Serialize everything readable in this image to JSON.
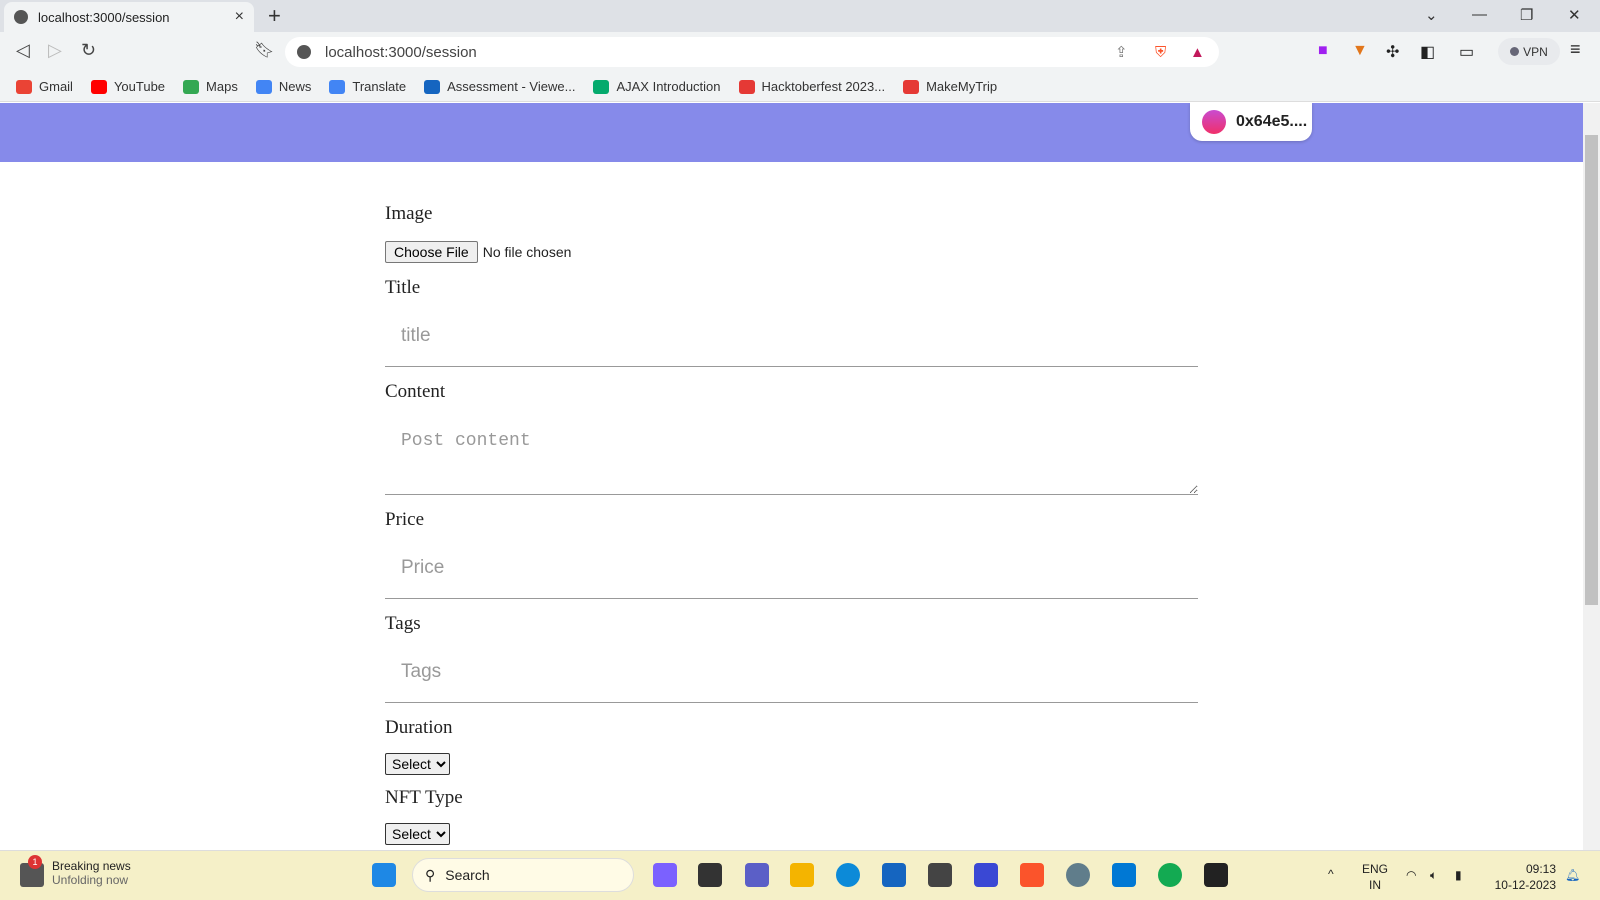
{
  "browser": {
    "tab_title": "localhost:3000/session",
    "url": "localhost:3000/session",
    "vpn_label": "VPN",
    "bookmarks": [
      {
        "label": "Gmail",
        "color": "#ea4335"
      },
      {
        "label": "YouTube",
        "color": "#ff0000"
      },
      {
        "label": "Maps",
        "color": "#34a853"
      },
      {
        "label": "News",
        "color": "#4285f4"
      },
      {
        "label": "Translate",
        "color": "#4285f4"
      },
      {
        "label": "Assessment - Viewe...",
        "color": "#1565c0"
      },
      {
        "label": "AJAX Introduction",
        "color": "#04aa6d"
      },
      {
        "label": "Hacktoberfest 2023...",
        "color": "#e53935"
      },
      {
        "label": "MakeMyTrip",
        "color": "#e53935"
      }
    ]
  },
  "header": {
    "wallet_address": "0x64e5....",
    "color": "#868aea"
  },
  "form": {
    "image_label": "Image",
    "choose_file": "Choose File",
    "no_file": "No file chosen",
    "title_label": "Title",
    "title_placeholder": "title",
    "content_label": "Content",
    "content_placeholder": "Post content",
    "price_label": "Price",
    "price_placeholder": "Price",
    "tags_label": "Tags",
    "tags_placeholder": "Tags",
    "duration_label": "Duration",
    "duration_value": "Select",
    "nft_type_label": "NFT Type",
    "nft_type_value": "Select"
  },
  "taskbar": {
    "news_title": "Breaking news",
    "news_sub": "Unfolding now",
    "news_badge": "1",
    "search": "Search",
    "lang1": "ENG",
    "lang2": "IN",
    "time": "09:13",
    "date": "10-12-2023"
  }
}
